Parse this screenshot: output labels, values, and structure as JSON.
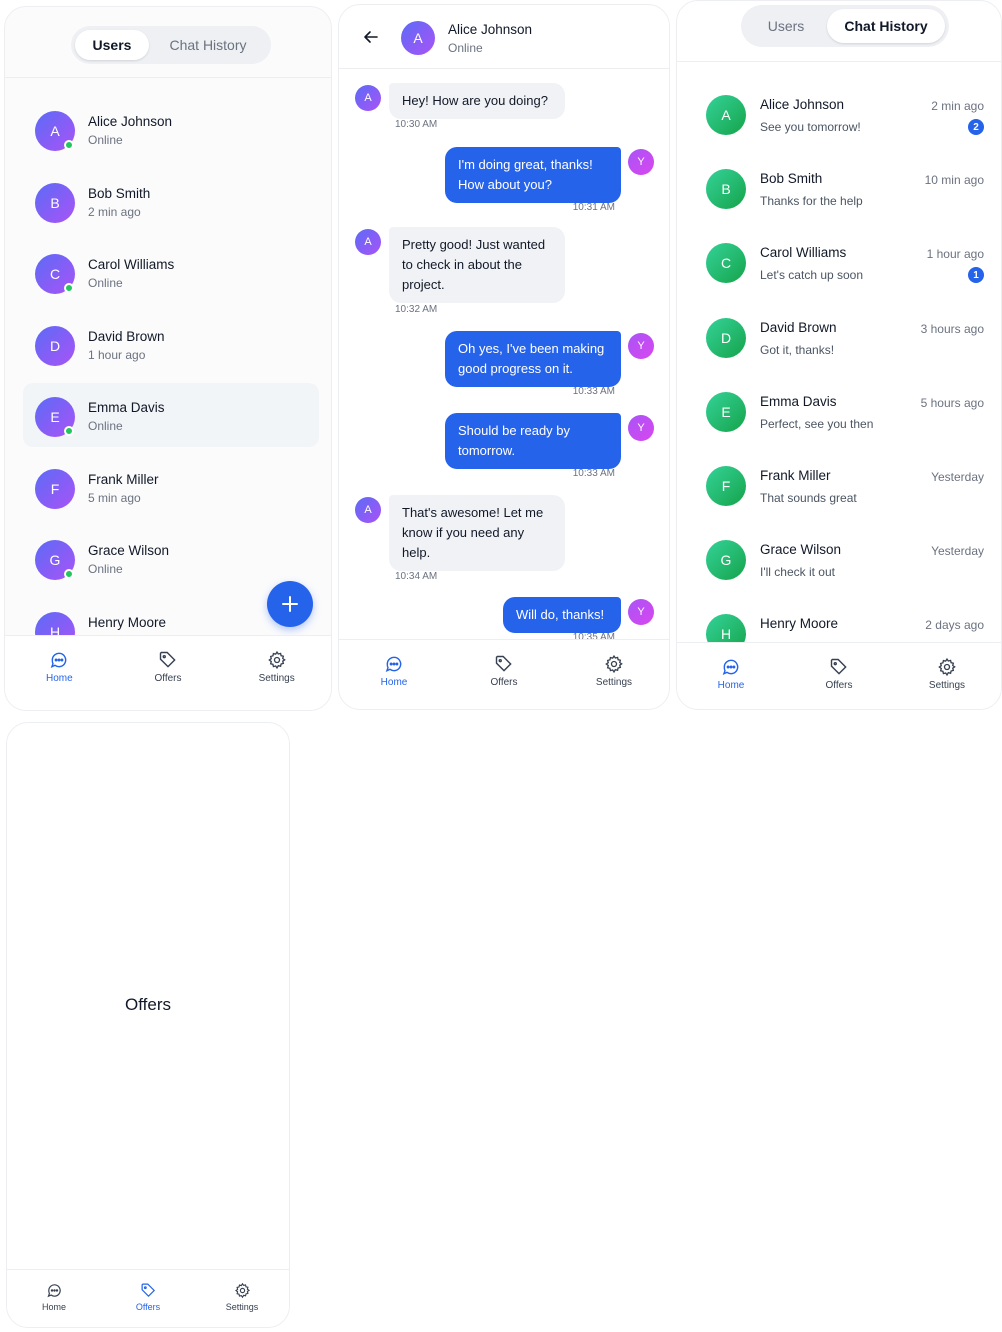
{
  "users_screen": {
    "tabs": [
      "Users",
      "Chat History"
    ],
    "users": [
      {
        "initial": "A",
        "name": "Alice Johnson",
        "status": "Online",
        "online": true
      },
      {
        "initial": "B",
        "name": "Bob Smith",
        "status": "2 min ago",
        "online": false
      },
      {
        "initial": "C",
        "name": "Carol Williams",
        "status": "Online",
        "online": true
      },
      {
        "initial": "D",
        "name": "David Brown",
        "status": "1 hour ago",
        "online": false
      },
      {
        "initial": "E",
        "name": "Emma Davis",
        "status": "Online",
        "online": true
      },
      {
        "initial": "F",
        "name": "Frank Miller",
        "status": "5 min ago",
        "online": false
      },
      {
        "initial": "G",
        "name": "Grace Wilson",
        "status": "Online",
        "online": true
      },
      {
        "initial": "H",
        "name": "Henry Moore",
        "status": "",
        "online": false
      }
    ],
    "fab_icon": "plus-icon"
  },
  "chat_screen": {
    "contact_initial": "A",
    "contact_name": "Alice Johnson",
    "contact_status": "Online",
    "messages": [
      {
        "from": "them",
        "initial": "A",
        "text": "Hey! How are you doing?",
        "time": "10:30 AM"
      },
      {
        "from": "me",
        "initial": "Y",
        "text": "I'm doing great, thanks! How about you?",
        "time": "10:31 AM"
      },
      {
        "from": "them",
        "initial": "A",
        "text": "Pretty good! Just wanted to check in about the project.",
        "time": "10:32 AM"
      },
      {
        "from": "me",
        "initial": "Y",
        "text": "Oh yes, I've been making good progress on it.",
        "time": "10:33 AM"
      },
      {
        "from": "me",
        "initial": "Y",
        "text": "Should be ready by tomorrow.",
        "time": "10:33 AM"
      },
      {
        "from": "them",
        "initial": "A",
        "text": "That's awesome! Let me know if you need any help.",
        "time": "10:34 AM"
      },
      {
        "from": "me",
        "initial": "Y",
        "text": "Will do, thanks!",
        "time": "10:35 AM"
      }
    ]
  },
  "history_screen": {
    "tabs": [
      "Users",
      "Chat History"
    ],
    "conversations": [
      {
        "initial": "A",
        "name": "Alice Johnson",
        "last_message": "See you tomorrow!",
        "time": "2 min ago",
        "unread": "2"
      },
      {
        "initial": "B",
        "name": "Bob Smith",
        "last_message": "Thanks for the help",
        "time": "10 min ago",
        "unread": ""
      },
      {
        "initial": "C",
        "name": "Carol Williams",
        "last_message": "Let's catch up soon",
        "time": "1 hour ago",
        "unread": "1"
      },
      {
        "initial": "D",
        "name": "David Brown",
        "last_message": "Got it, thanks!",
        "time": "3 hours ago",
        "unread": ""
      },
      {
        "initial": "E",
        "name": "Emma Davis",
        "last_message": "Perfect, see you then",
        "time": "5 hours ago",
        "unread": ""
      },
      {
        "initial": "F",
        "name": "Frank Miller",
        "last_message": "That sounds great",
        "time": "Yesterday",
        "unread": ""
      },
      {
        "initial": "G",
        "name": "Grace Wilson",
        "last_message": "I'll check it out",
        "time": "Yesterday",
        "unread": ""
      },
      {
        "initial": "H",
        "name": "Henry Moore",
        "last_message": "",
        "time": "2 days ago",
        "unread": ""
      }
    ]
  },
  "offers_screen": {
    "title": "Offers"
  },
  "nav": {
    "home": "Home",
    "offers": "Offers",
    "settings": "Settings"
  },
  "colors": {
    "accent": "#2563eb",
    "online": "#22c55e",
    "avatar_purple": "#7c5cf6",
    "avatar_green": "#34c27a"
  }
}
